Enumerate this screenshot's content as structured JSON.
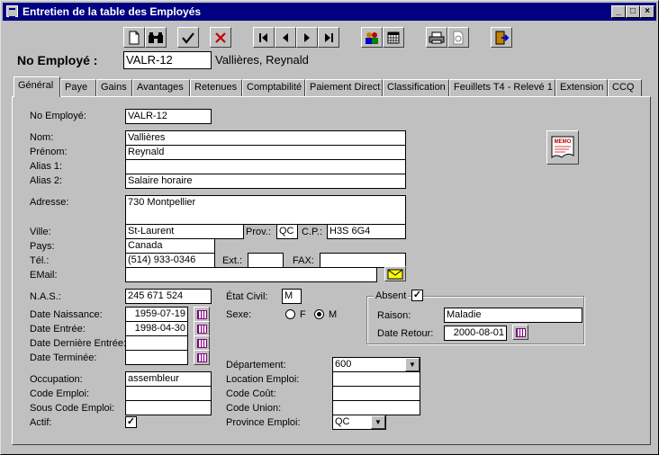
{
  "window": {
    "title": "Entretien de la table des Employés",
    "minimize": "_",
    "maximize": "□",
    "close": "×"
  },
  "toolbar": {
    "new_icon": "new-document-icon",
    "find_icon": "binoculars-icon",
    "save_icon": "checkmark-icon",
    "cancel_icon": "x-delete-icon",
    "first_icon": "first-record-icon",
    "prev_icon": "previous-record-icon",
    "next_icon": "next-record-icon",
    "last_icon": "last-record-icon",
    "users_icon": "people-icon",
    "calendar_icon": "calendar-icon",
    "print_icon": "printer-icon",
    "preview_icon": "print-preview-icon",
    "exit_icon": "exit-door-icon"
  },
  "header": {
    "label": "No Employé :",
    "employee_no": "VALR-12",
    "employee_name": "Vallières, Reynald"
  },
  "tabs": [
    "Général",
    "Paye",
    "Gains",
    "Avantages",
    "Retenues",
    "Comptabilité",
    "Paiement Direct",
    "Classification",
    "Feuillets T4 - Relevé 1",
    "Extension",
    "CCQ"
  ],
  "general": {
    "no_employe_label": "No Employé:",
    "no_employe": "VALR-12",
    "nom_label": "Nom:",
    "nom": "Vallières",
    "prenom_label": "Prénom:",
    "prenom": "Reynald",
    "alias1_label": "Alias 1:",
    "alias1": "",
    "alias2_label": "Alias 2:",
    "alias2": "Salaire horaire",
    "adresse_label": "Adresse:",
    "adresse": "730 Montpellier",
    "ville_label": "Ville:",
    "ville": "St-Laurent",
    "prov_label": "Prov.:",
    "prov": "QC",
    "cp_label": "C.P.:",
    "cp": "H3S 6G4",
    "pays_label": "Pays:",
    "pays": "Canada",
    "tel_label": "Tél.:",
    "tel": "(514) 933-0346",
    "ext_label": "Ext.:",
    "ext": "",
    "fax_label": "FAX:",
    "fax": "",
    "email_label": "EMail:",
    "email": "",
    "memo_text": "MEMO",
    "nas_label": "N.A.S.:",
    "nas": "245 671 524",
    "date_naissance_label": "Date Naissance:",
    "date_naissance": "1959-07-19",
    "date_entree_label": "Date Entrée:",
    "date_entree": "1998-04-30",
    "date_derniere_entree_label": "Date Dernière Entrée:",
    "date_derniere_entree": "",
    "date_terminee_label": "Date Terminée:",
    "date_terminee": "",
    "etat_civil_label": "État Civil:",
    "etat_civil": "M",
    "sexe_label": "Sexe:",
    "sexe_f": "F",
    "sexe_m": "M",
    "absent_label": "Absent",
    "raison_label": "Raison:",
    "raison": "Maladie",
    "date_retour_label": "Date Retour:",
    "date_retour": "2000-08-01",
    "occupation_label": "Occupation:",
    "occupation": "assembleur",
    "code_emploi_label": "Code Emploi:",
    "code_emploi": "",
    "sous_code_emploi_label": "Sous Code Emploi:",
    "sous_code_emploi": "",
    "actif_label": "Actif:",
    "departement_label": "Département:",
    "departement": "600",
    "location_emploi_label": "Location Emploi:",
    "location_emploi": "",
    "code_cout_label": "Code Coût:",
    "code_cout": "",
    "code_union_label": "Code Union:",
    "code_union": "",
    "province_emploi_label": "Province Emploi:",
    "province_emploi": "QC"
  }
}
